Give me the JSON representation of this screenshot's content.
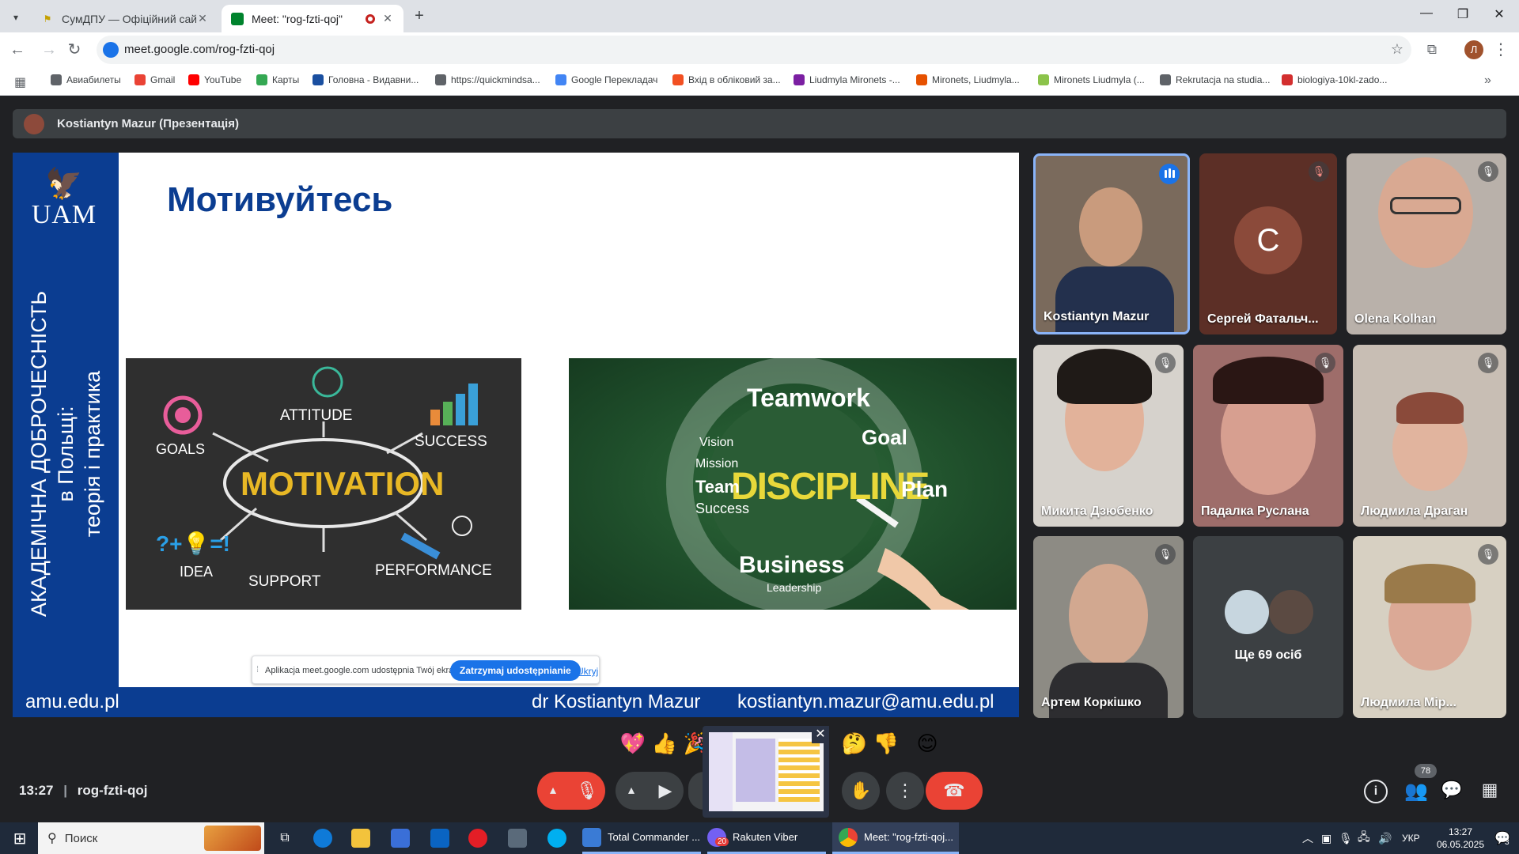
{
  "browser": {
    "tabs": [
      {
        "title": "СумДПУ — Офіційний сайт Су",
        "active": false
      },
      {
        "title": "Meet: \"rog-fzti-qoj\"",
        "active": true
      }
    ],
    "url": "meet.google.com/rog-fzti-qoj",
    "profile_initial": "Л"
  },
  "bookmarks": [
    {
      "label": "Авиабилеты",
      "color": "#5f6368"
    },
    {
      "label": "Gmail",
      "color": "#ea4335"
    },
    {
      "label": "YouTube",
      "color": "#ff0000"
    },
    {
      "label": "Карты",
      "color": "#34a853"
    },
    {
      "label": "Головна - Видавни...",
      "color": "#1a4fa0"
    },
    {
      "label": "https://quickmindsa...",
      "color": "#5f6368"
    },
    {
      "label": "Google Перекладач",
      "color": "#4285f4"
    },
    {
      "label": "Вхід в обліковий за...",
      "color": "#f25022"
    },
    {
      "label": "Liudmyla Mironets -...",
      "color": "#7b1fa2"
    },
    {
      "label": "Mironets, Liudmyla...",
      "color": "#e65100"
    },
    {
      "label": "Mironets Liudmyla (...",
      "color": "#8bc34a"
    },
    {
      "label": "Rekrutacja na studia...",
      "color": "#5f6368"
    },
    {
      "label": "biologiya-10kl-zado...",
      "color": "#d32f2f"
    }
  ],
  "presenter": {
    "name": "Kostiantyn Mazur (Презентація)"
  },
  "slide": {
    "logo_text": "UAM",
    "vertical_line1": "АКАДЕМІЧНА ДОБРОЧЕСНІСТЬ",
    "vertical_line2": "в Польщі:",
    "vertical_line3": "теорія і практика",
    "title": "Мотивуйтесь",
    "motivation_words": {
      "center": "MOTIVATION",
      "goals": "GOALS",
      "attitude": "ATTITUDE",
      "success": "SUCCESS",
      "idea": "IDEA",
      "support": "SUPPORT",
      "performance": "PERFORMANCE",
      "formula": "?+💡=!"
    },
    "discipline_words": {
      "center": "DISCIPLINE",
      "teamwork": "Teamwork",
      "goal": "Goal",
      "business": "Business",
      "team": "Team",
      "plan": "Plan",
      "vision": "Vision",
      "mission": "Mission",
      "success": "Success",
      "leadership": "Leadership"
    },
    "footer_site": "amu.edu.pl",
    "footer_author": "dr Kostiantyn Mazur",
    "footer_email": "kostiantyn.mazur@amu.edu.pl",
    "share_notice": {
      "message": "Aplikacja meet.google.com udostępnia Twój ekran.",
      "stop_label": "Zatrzymaj udostępnianie",
      "hide_label": "Ukryj"
    }
  },
  "participants": [
    {
      "name": "Kostiantyn Mazur",
      "speaking": true
    },
    {
      "name": "Сергей Фатальч...",
      "initial": "C",
      "muted": true
    },
    {
      "name": "Olena Kolhan",
      "muted": true
    },
    {
      "name": "Микита Дзюбенко",
      "muted": true
    },
    {
      "name": "Падалка Руслана",
      "muted": true
    },
    {
      "name": "Людмила Драган",
      "muted": true
    },
    {
      "name": "Артем Коркішко",
      "muted": true
    },
    {
      "name": "Ще 69 осіб"
    },
    {
      "name": "Людмила Мір...",
      "muted": true
    }
  ],
  "meeting": {
    "time": "13:27",
    "code": "rog-fzti-qoj",
    "participant_count": "78",
    "reactions": [
      "💖",
      "👍",
      "🎉",
      "🤔",
      "👎",
      "😊"
    ]
  },
  "taskbar": {
    "search_label": "Поиск",
    "apps": [
      {
        "label": "Total Commander ..."
      },
      {
        "label": "Rakuten Viber",
        "badge": "20"
      },
      {
        "label": "Meet: \"rog-fzti-qoj..."
      }
    ],
    "language": "УКР",
    "time": "13:27",
    "date": "06.05.2025",
    "notifications": "3"
  }
}
